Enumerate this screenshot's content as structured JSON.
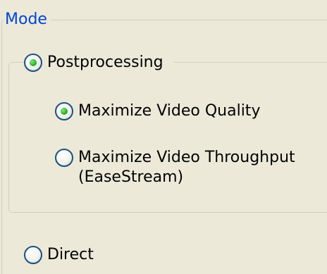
{
  "mode": {
    "title": "Mode",
    "options": [
      {
        "label": "Postprocessing",
        "selected": true,
        "sub_options": [
          {
            "label": "Maximize Video Quality",
            "selected": true
          },
          {
            "label_lines": [
              "Maximize Video Throughput",
              "(EaseStream)"
            ],
            "selected": false
          }
        ]
      },
      {
        "label": "Direct",
        "selected": false
      }
    ]
  },
  "colors": {
    "background": "#ece9d8",
    "group_title": "#0046d5",
    "group_border": "#d0d0bf",
    "radio_border": "#1c5180",
    "radio_dot": "#2fb62f"
  }
}
